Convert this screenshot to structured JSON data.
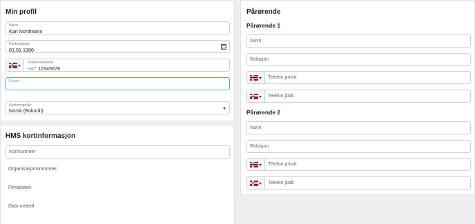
{
  "profile": {
    "title": "Min profil",
    "name_label": "Navn",
    "name_value": "Kari Nordmann",
    "birth_label": "Fødselsdato:",
    "birth_value": "01.01.1980",
    "phone_label": "Telefonnummer",
    "phone_prefix": "+47",
    "phone_value": "12345678",
    "email_label": "Epost:",
    "email_value": "",
    "language_label": "Systemspråk:",
    "language_value": "Norsk (Bokmål)"
  },
  "hms": {
    "title": "HMS kortinformasjon",
    "card_placeholder": "Kortnummer",
    "org_label": "Organisasjonsnummer",
    "company_label": "Firmanavn",
    "date_label": "Dato utstedt"
  },
  "relatives": {
    "title": "Pårørende",
    "groups": [
      {
        "title": "Pårørende 1",
        "name_placeholder": "Navn",
        "relation_placeholder": "Relasjon",
        "phone_private_placeholder": "Telefon privat",
        "phone_work_placeholder": "Telefon jobb"
      },
      {
        "title": "Pårørende 2",
        "name_placeholder": "Navn",
        "relation_placeholder": "Relasjon",
        "phone_private_placeholder": "Telefon privat",
        "phone_work_placeholder": "Telefon jobb"
      }
    ]
  },
  "icons": {
    "flag": "norway-flag-icon",
    "calendar": "calendar-icon",
    "dropdown": "chevron-down-icon"
  },
  "colors": {
    "focus_border": "#5aa7c3",
    "background": "#efefef",
    "flag_red": "#ba0c2f",
    "flag_blue": "#00205b"
  }
}
